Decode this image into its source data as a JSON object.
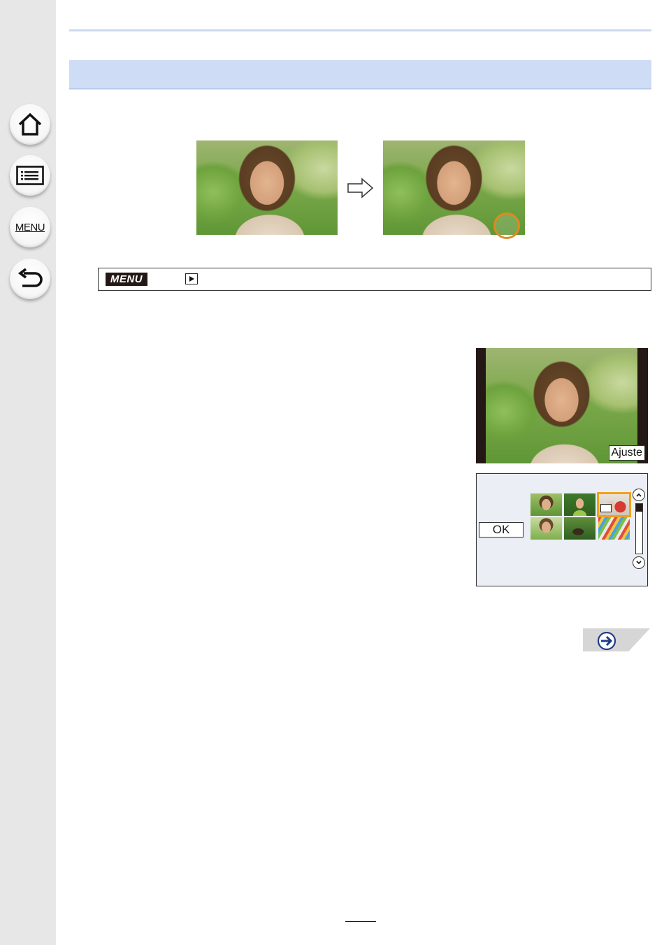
{
  "sidebar": {
    "items": [
      {
        "name": "home",
        "icon": "home-icon"
      },
      {
        "name": "contents",
        "icon": "list-icon"
      },
      {
        "name": "menu",
        "label": "MENU"
      },
      {
        "name": "back",
        "icon": "back-arrow-icon"
      }
    ]
  },
  "example": {
    "before_image": "portrait-photo",
    "after_image": "portrait-photo-with-marker",
    "arrow_icon": "right-arrow-icon",
    "marker_color": "#e08a1e"
  },
  "menu_path": {
    "menu_label": "MENU",
    "playback_icon": "playback-icon"
  },
  "screen_preview": {
    "set_button_label": "Ajuste"
  },
  "screen_selection": {
    "ok_label": "OK",
    "thumbnails": [
      "portrait",
      "child",
      "selected-frame",
      "portrait-2",
      "shoes",
      "pencils"
    ],
    "selected_index": 2,
    "selection_color": "#f0a11c"
  },
  "next_page": {
    "icon": "next-page-arrow-icon"
  },
  "page_number": ""
}
